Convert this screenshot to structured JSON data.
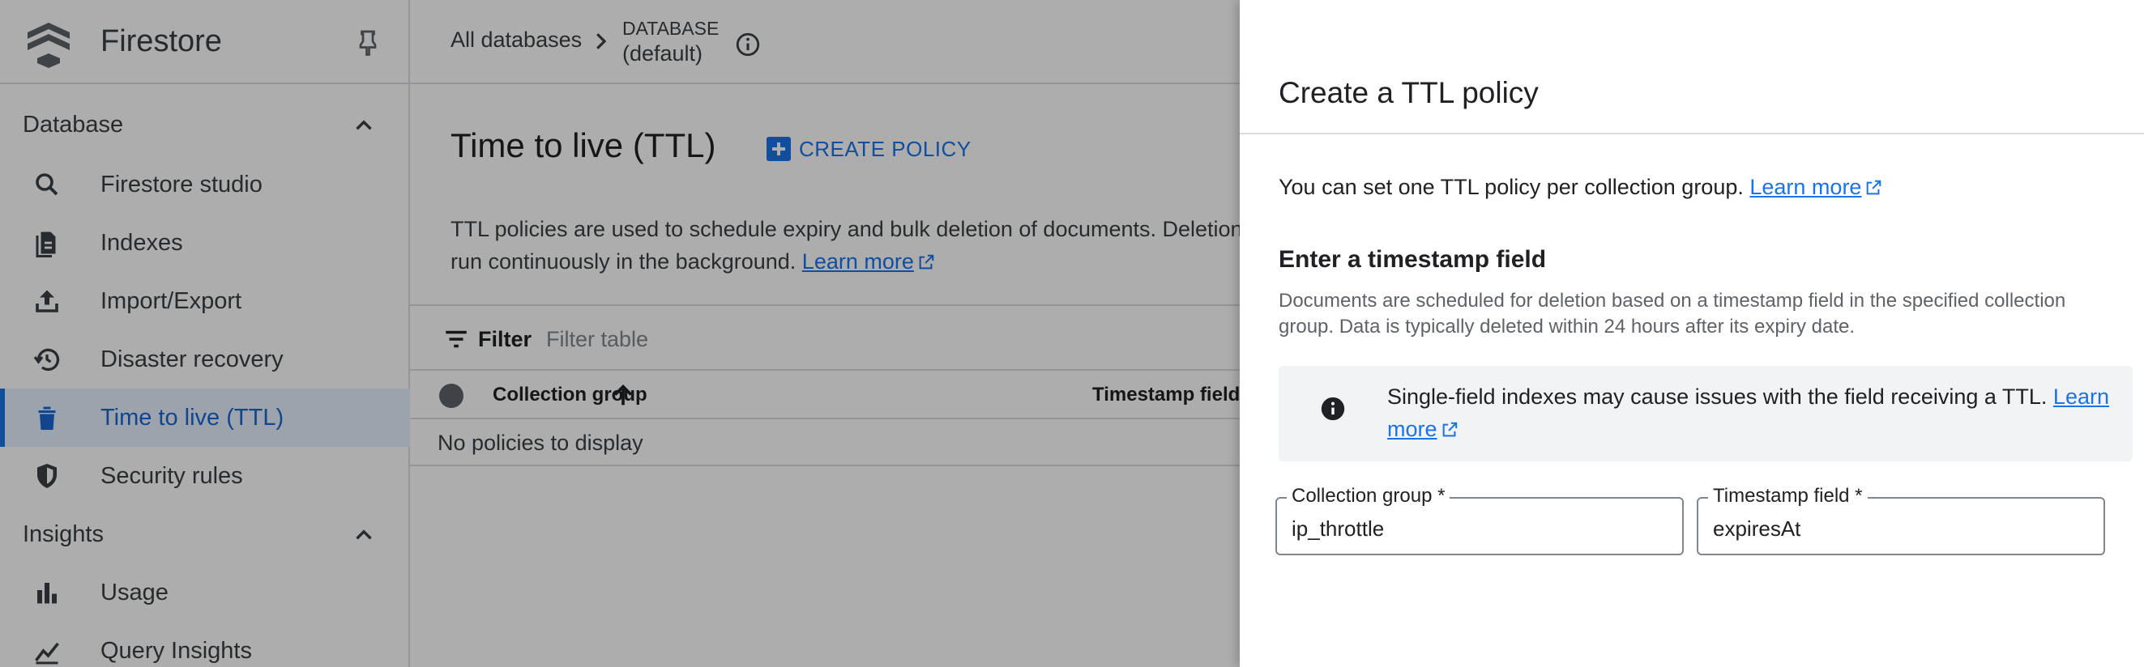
{
  "sidebar": {
    "product_name": "Firestore",
    "sections": [
      {
        "label": "Database",
        "items": [
          {
            "label": "Firestore studio",
            "icon": "search-icon"
          },
          {
            "label": "Indexes",
            "icon": "indexes-icon"
          },
          {
            "label": "Import/Export",
            "icon": "upload-icon"
          },
          {
            "label": "Disaster recovery",
            "icon": "history-icon"
          },
          {
            "label": "Time to live (TTL)",
            "icon": "trash-icon",
            "active": true
          },
          {
            "label": "Security rules",
            "icon": "shield-icon"
          }
        ]
      },
      {
        "label": "Insights",
        "items": [
          {
            "label": "Usage",
            "icon": "bar-chart-icon"
          },
          {
            "label": "Query Insights",
            "icon": "query-insights-icon"
          }
        ]
      }
    ]
  },
  "header": {
    "breadcrumb_link": "All databases",
    "database_label": "DATABASE",
    "database_name": "(default)"
  },
  "main": {
    "title": "Time to live (TTL)",
    "create_button": "CREATE POLICY",
    "description_line1": "TTL policies are used to schedule expiry and bulk deletion of documents. Deletion job",
    "description_line2": "run continuously in the background.",
    "learn_more": "Learn more",
    "filter": {
      "label": "Filter",
      "placeholder": "Filter table"
    },
    "table": {
      "columns": [
        "Collection group",
        "Timestamp field"
      ],
      "empty_message": "No policies to display"
    }
  },
  "panel": {
    "title": "Create a TTL policy",
    "intro": "You can set one TTL policy per collection group.",
    "intro_link": "Learn more",
    "section_title": "Enter a timestamp field",
    "section_description": "Documents are scheduled for deletion based on a timestamp field in the specified collection group. Data is typically deleted within 24 hours after its expiry date.",
    "notice_text": "Single-field indexes may cause issues with the field receiving a TTL.",
    "notice_link": "Learn more",
    "fields": [
      {
        "label": "Collection group *",
        "value": "ip_throttle"
      },
      {
        "label": "Timestamp field *",
        "value": "expiresAt"
      }
    ]
  },
  "colors": {
    "accent": "#1a73e8",
    "active_nav_bg": "#e8f0fe",
    "scrim": "rgba(0,0,0,0.32)"
  }
}
